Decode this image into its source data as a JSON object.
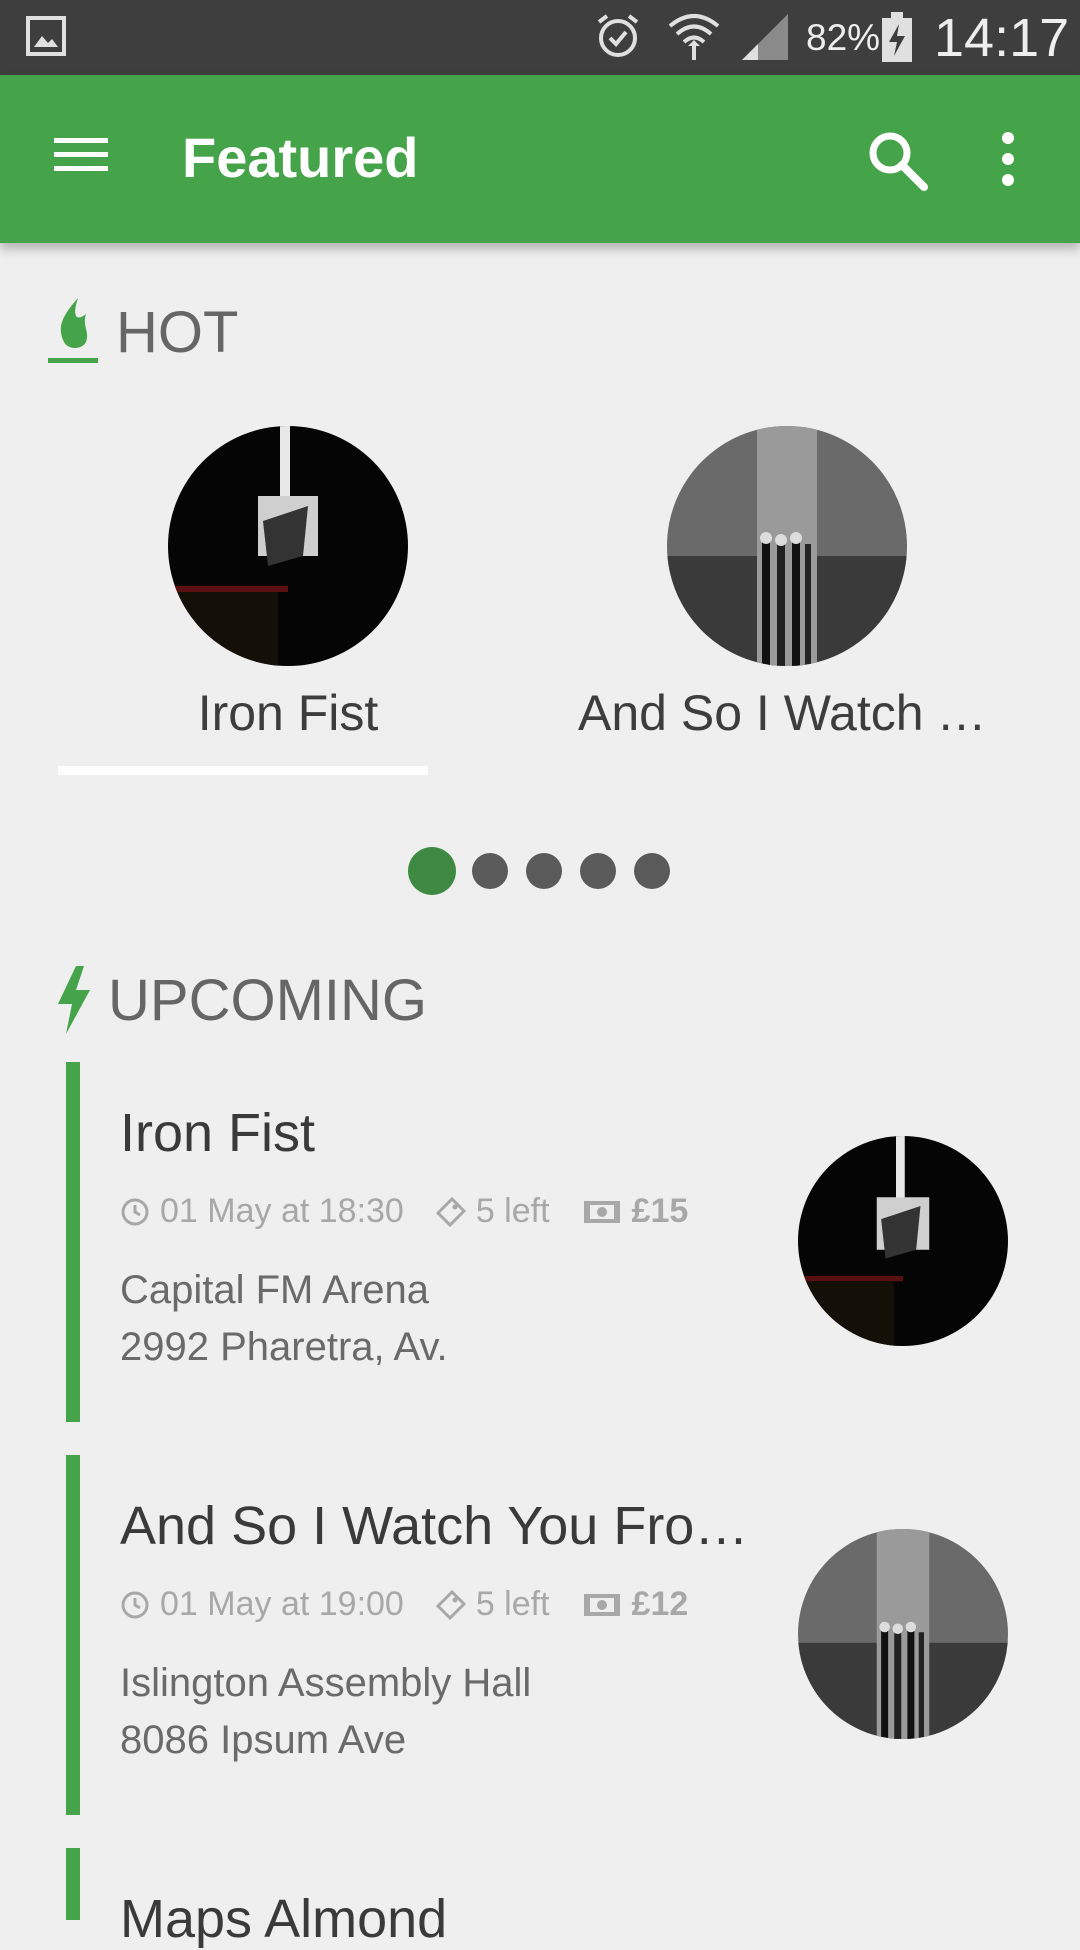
{
  "status_bar": {
    "battery_pct": "82%",
    "time": "14:17",
    "icons": [
      "image-icon",
      "alarm-icon",
      "wifi-icon",
      "signal-icon",
      "battery-charging-icon"
    ]
  },
  "app_bar": {
    "title": "Featured",
    "color": "#45a349",
    "icons": [
      "menu-icon",
      "search-icon",
      "more-vert-icon"
    ]
  },
  "hot": {
    "heading": "HOT",
    "icon": "flame-icon",
    "items": [
      {
        "name": "Iron Fist"
      },
      {
        "name": "And So I Watch You From Afar"
      }
    ],
    "carousel_page_count": 5,
    "carousel_active_index": 0
  },
  "upcoming": {
    "heading": "UPCOMING",
    "icon": "lightning-icon",
    "events": [
      {
        "title": "Iron Fist",
        "datetime": "01 May at 18:30",
        "tickets_left": "5 left",
        "price": "£15",
        "venue": "Capital FM Arena",
        "address": "2992 Pharetra, Av."
      },
      {
        "title": "And So I Watch You From Afar",
        "datetime": "01 May at 19:00",
        "tickets_left": "5 left",
        "price": "£12",
        "venue": "Islington Assembly Hall",
        "address": "8086 Ipsum Ave"
      },
      {
        "title": "Maps Almond"
      }
    ]
  },
  "colors": {
    "accent": "#45a349",
    "active_dot": "#3f8a43",
    "background": "#efefef"
  }
}
